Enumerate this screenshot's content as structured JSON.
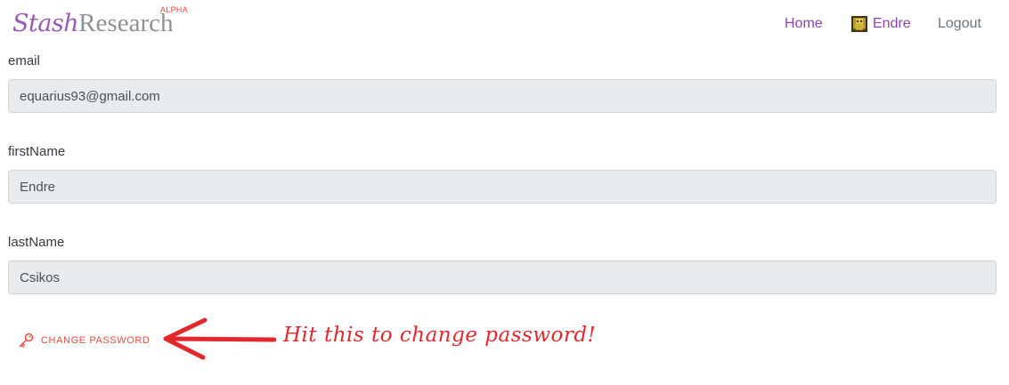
{
  "brand": {
    "part1": "Stash",
    "part2": "Research",
    "badge": "ALPHA"
  },
  "nav": {
    "home": "Home",
    "user": "Endre",
    "logout": "Logout"
  },
  "form": {
    "email": {
      "label": "email",
      "value": "equarius93@gmail.com"
    },
    "firstName": {
      "label": "firstName",
      "value": "Endre"
    },
    "lastName": {
      "label": "lastName",
      "value": "Csikos"
    }
  },
  "actions": {
    "change_password": "CHANGE PASSWORD"
  },
  "annotation": {
    "text": "Hit this to change password!"
  },
  "colors": {
    "brand_purple": "#9b59b6",
    "link_purple": "#8e44ad",
    "danger_red": "#e74c3c",
    "annotation_red": "#e0282d",
    "input_bg": "#e9ecef"
  },
  "icons": {
    "avatar": "user-avatar-icon",
    "change_password": "key-icon",
    "annotation": "arrow-left-icon"
  }
}
